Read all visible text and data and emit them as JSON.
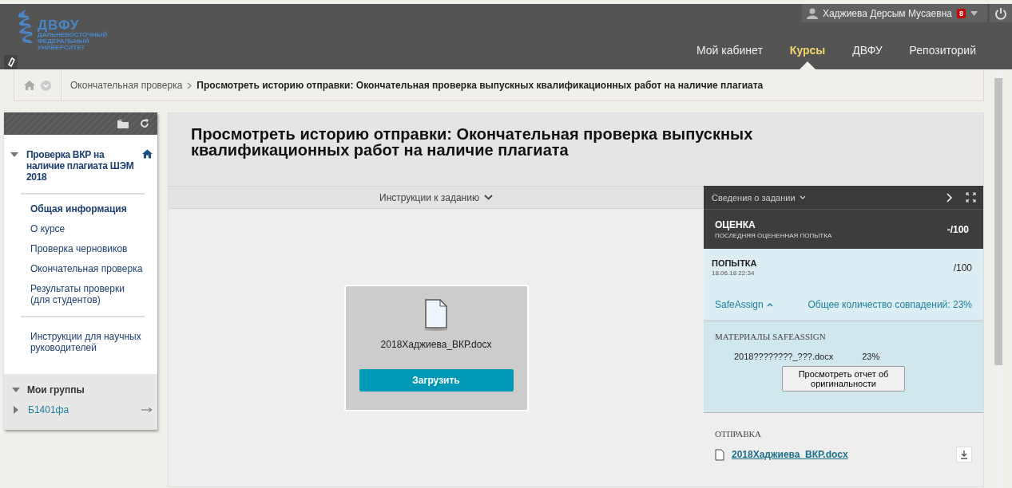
{
  "header": {
    "logo": {
      "name": "ДВФУ",
      "subtitle": [
        "ДАЛЬНЕВОСТОЧНЫЙ",
        "ФЕДЕРАЛЬНЫЙ",
        "УНИВЕРСИТЕТ"
      ]
    },
    "user": {
      "name": "Хаджиева Дерсым Мусаевна",
      "badge": "8"
    },
    "nav": [
      {
        "label": "Мой кабинет",
        "selected": false
      },
      {
        "label": "Курсы",
        "selected": true
      },
      {
        "label": "ДВФУ",
        "selected": false
      },
      {
        "label": "Репозиторий",
        "selected": false
      }
    ]
  },
  "breadcrumb": {
    "items": [
      "Окончательная проверка"
    ],
    "current": "Просмотреть историю отправки: Окончательная проверка выпускных квалификационных работ на наличие плагиата"
  },
  "course_menu": {
    "course_title": "Проверка ВКР на наличие плагиата ШЭМ 2018",
    "expanded": true,
    "sections": [
      [
        {
          "label": "Общая информация",
          "selected": true
        },
        {
          "label": "О курсе",
          "selected": false
        },
        {
          "label": "Проверка черновиков",
          "selected": false
        },
        {
          "label": "Окончательная проверка",
          "selected": false
        },
        {
          "label": "Результаты проверки (для студентов)",
          "selected": false
        }
      ],
      [
        {
          "label": "Инструкции для научных руководителей",
          "selected": false
        }
      ]
    ],
    "groups": {
      "title": "Мои группы",
      "expanded": true,
      "items": [
        {
          "label": "Б1401фа",
          "expanded": false
        }
      ]
    }
  },
  "page": {
    "title": "Просмотреть историю отправки: Окончательная проверка выпускных квалификационных работ на наличие плагиата",
    "instructions_toggle": "Инструкции к заданию",
    "file": {
      "name": "2018Хаджиева_ВКР.docx",
      "button": "Загрузить"
    }
  },
  "details": {
    "header": "Сведения о задании",
    "grade": {
      "title": "ОЦЕНКА",
      "subtitle": "ПОСЛЕДНЯЯ ОЦЕНЕННАЯ ПОПЫТКА",
      "value": "-/100"
    },
    "attempt": {
      "title": "ПОПЫТКА",
      "date": "18.06.18 22:34",
      "value": "/100"
    },
    "safeassign": {
      "label": "SafeAssign",
      "expanded": true,
      "overall": "Общее количество совпадений: 23%",
      "materials_title": "МАТЕРИАЛЫ SAFEASSIGN",
      "file": "2018????????_???.docx",
      "percent": "23%",
      "report_button": "Просмотреть отчет об оригинальности"
    },
    "submission": {
      "title": "ОТПРАВКА",
      "file": "2018Хаджиева_ВКР.docx"
    }
  }
}
